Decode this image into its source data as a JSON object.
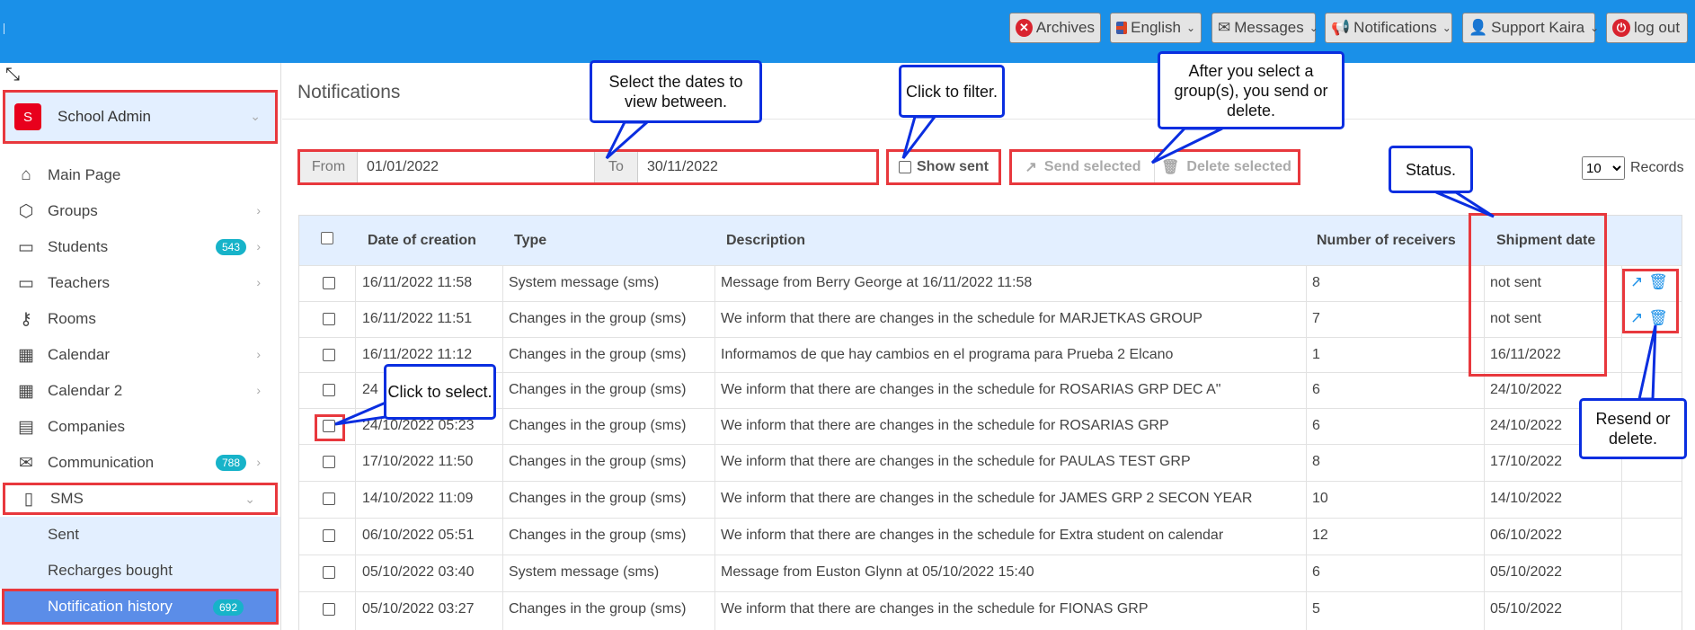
{
  "topbar": {
    "archives": "Archives",
    "language": "English",
    "messages": "Messages",
    "notifications": "Notifications",
    "user": "Support Kaira",
    "logout": "log out"
  },
  "sidebar": {
    "org": {
      "avatar": "S",
      "name": "School Admin"
    },
    "items": [
      {
        "label": "Main Page",
        "icon": "home-icon"
      },
      {
        "label": "Groups",
        "icon": "cube-icon"
      },
      {
        "label": "Students",
        "icon": "id-card-icon",
        "badge": "543"
      },
      {
        "label": "Teachers",
        "icon": "id-card-icon"
      },
      {
        "label": "Rooms",
        "icon": "key-icon"
      },
      {
        "label": "Calendar",
        "icon": "calendar-icon"
      },
      {
        "label": "Calendar 2",
        "icon": "calendar-icon"
      },
      {
        "label": "Companies",
        "icon": "building-icon"
      },
      {
        "label": "Communication",
        "icon": "envelope-icon",
        "badge": "788"
      },
      {
        "label": "SMS",
        "icon": "phone-icon"
      }
    ],
    "sms_sub": [
      {
        "label": "Sent"
      },
      {
        "label": "Recharges bought"
      },
      {
        "label": "Notification history",
        "badge": "692"
      }
    ]
  },
  "page": {
    "title": "Notifications",
    "from_label": "From",
    "from_value": "01/01/2022",
    "to_label": "To",
    "to_value": "30/11/2022",
    "show_sent": "Show sent",
    "send_selected": "Send selected",
    "delete_selected": "Delete selected",
    "records_value": "10",
    "records_label": "Records"
  },
  "table": {
    "headers": [
      "Date of creation",
      "Type",
      "Description",
      "Number of receivers",
      "Shipment date"
    ],
    "rows": [
      {
        "date": "16/11/2022 11:58",
        "type": "System message (sms)",
        "desc": "Message from Berry George at 16/11/2022 11:58",
        "receivers": "8",
        "shipment": "not sent"
      },
      {
        "date": "16/11/2022 11:51",
        "type": "Changes in the group (sms)",
        "desc": "We inform that there are changes in the schedule for MARJETKAS GROUP",
        "receivers": "7",
        "shipment": "not sent"
      },
      {
        "date": "16/11/2022 11:12",
        "type": "Changes in the group (sms)",
        "desc": "Informamos de que hay cambios en el programa para Prueba 2 Elcano",
        "receivers": "1",
        "shipment": "16/11/2022"
      },
      {
        "date": "24",
        "type": "Changes in the group (sms)",
        "desc": "We inform that there are changes in the schedule for ROSARIAS GRP DEC A\"",
        "receivers": "6",
        "shipment": "24/10/2022"
      },
      {
        "date": "24/10/2022 05:23",
        "type": "Changes in the group (sms)",
        "desc": "We inform that there are changes in the schedule for ROSARIAS GRP",
        "receivers": "6",
        "shipment": "24/10/2022"
      },
      {
        "date": "17/10/2022 11:50",
        "type": "Changes in the group (sms)",
        "desc": "We inform that there are changes in the schedule for PAULAS TEST GRP",
        "receivers": "8",
        "shipment": "17/10/2022"
      },
      {
        "date": "14/10/2022 11:09",
        "type": "Changes in the group (sms)",
        "desc": "We inform that there are changes in the schedule for JAMES GRP 2 SECON YEAR",
        "receivers": "10",
        "shipment": "14/10/2022"
      },
      {
        "date": "06/10/2022 05:51",
        "type": "Changes in the group (sms)",
        "desc": "We inform that there are changes in the schedule for Extra student on calendar",
        "receivers": "12",
        "shipment": "06/10/2022"
      },
      {
        "date": "05/10/2022 03:40",
        "type": "System message (sms)",
        "desc": "Message from Euston Glynn at 05/10/2022 15:40",
        "receivers": "6",
        "shipment": "05/10/2022"
      },
      {
        "date": "05/10/2022 03:27",
        "type": "Changes in the group (sms)",
        "desc": "We inform that there are changes in the schedule for FIONAS GRP",
        "receivers": "5",
        "shipment": "05/10/2022"
      }
    ]
  },
  "callouts": {
    "dates": "Select the dates to view between.",
    "filter": "Click to filter.",
    "send_delete": "After you select a group(s), you send or delete.",
    "status": "Status.",
    "select": "Click to select.",
    "resend": "Resend or delete."
  },
  "colors": {
    "topbar": "#1a90e8",
    "highlight": "#e8383d",
    "callout_border": "#0a2ee0",
    "badge": "#17b3c9",
    "active_nav": "#5b8de8"
  }
}
